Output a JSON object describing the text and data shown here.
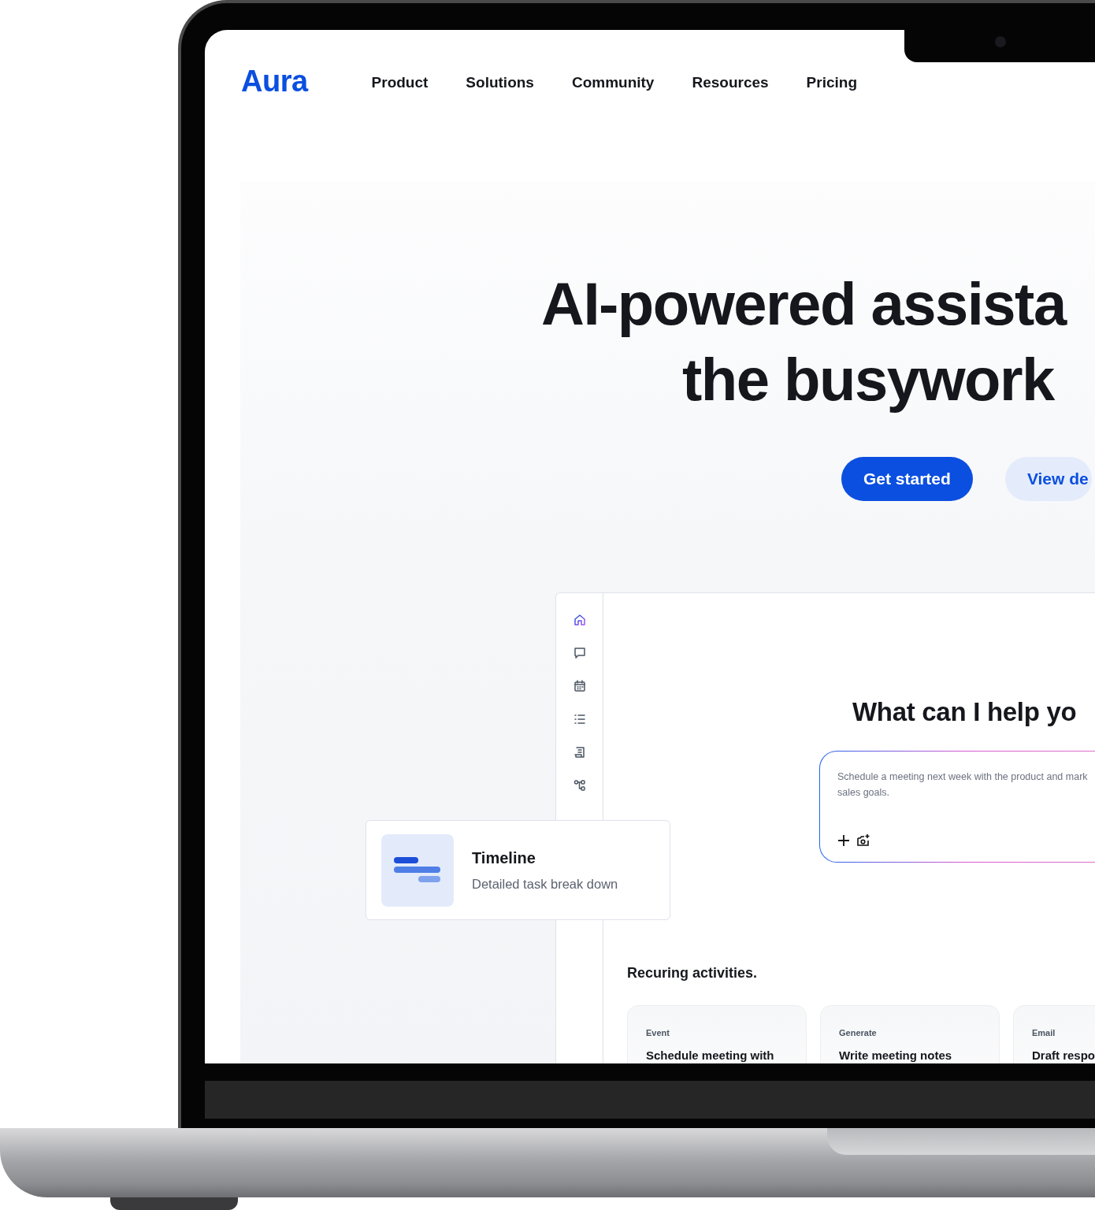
{
  "nav": {
    "logo": "Aura",
    "links": [
      "Product",
      "Solutions",
      "Community",
      "Resources",
      "Pricing"
    ]
  },
  "hero": {
    "headline_lines": [
      "AI-powered assista",
      "the busywork"
    ],
    "buttons": [
      {
        "label": "Get started",
        "kind": "primary"
      },
      {
        "label": "View de",
        "kind": "secondary"
      }
    ]
  },
  "app_preview": {
    "sidebar_items": [
      {
        "selected": true
      },
      {
        "selected": false
      },
      {
        "selected": false
      },
      {
        "selected": false
      },
      {
        "selected": false
      },
      {
        "selected": false
      }
    ],
    "title": "What can I help yo",
    "prompt": {
      "placeholder_lines": [
        "Schedule a meeting next week with the product and mark",
        "sales goals."
      ]
    },
    "section_title": "Recuring activities.",
    "activities": [
      {
        "category": "Event",
        "title": "Schedule meeting with"
      },
      {
        "category": "Generate",
        "title": "Write meeting notes"
      },
      {
        "category": "Email",
        "title": "Draft respo"
      }
    ]
  },
  "feature_card": {
    "title": "Timeline",
    "subtitle": "Detailed task break down"
  }
}
